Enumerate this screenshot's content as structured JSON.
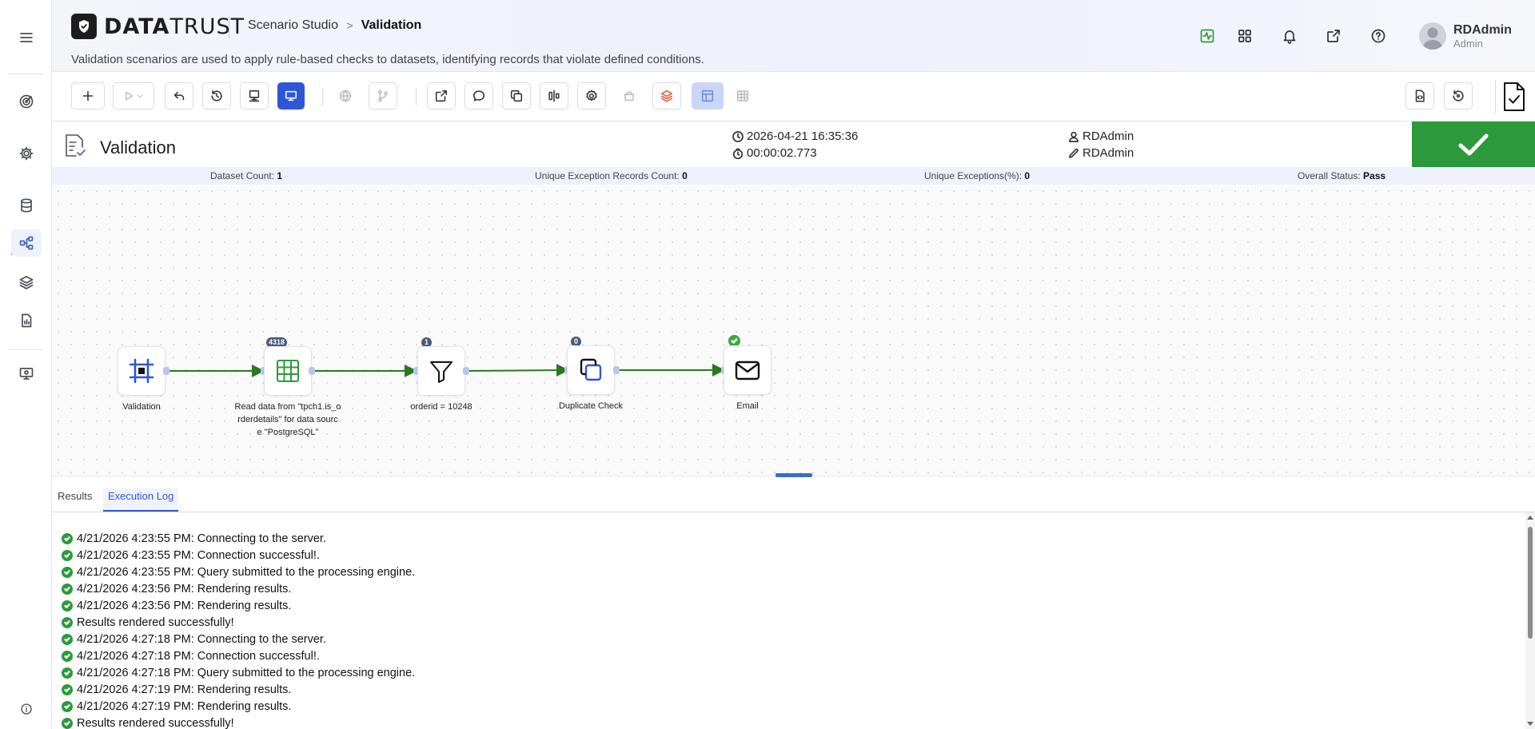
{
  "app": {
    "brand_bold": "DATA",
    "brand_light": "TRUST",
    "breadcrumb": {
      "parent": "Scenario Studio",
      "current": "Validation"
    },
    "subtitle": "Validation scenarios are used to apply rule-based checks to datasets, identifying records that violate defined conditions."
  },
  "user": {
    "name": "RDAdmin",
    "role": "Admin"
  },
  "header_icons": [
    "activity-icon",
    "apps-grid-icon",
    "bell-icon",
    "external-link-icon",
    "help-icon"
  ],
  "sidebar": {
    "items": [
      {
        "name": "target-icon",
        "active": false
      },
      {
        "name": "settings-icon",
        "active": false
      },
      {
        "name": "database-icon",
        "active": false
      },
      {
        "name": "workflow-icon",
        "active": true
      },
      {
        "name": "layers-icon",
        "active": false
      },
      {
        "name": "report-icon",
        "active": false
      },
      {
        "name": "monitor-icon",
        "active": false
      }
    ],
    "footer": "info-icon"
  },
  "scenario": {
    "title": "Validation",
    "run_datetime": "2026-04-21 16:35:36",
    "duration": "00:00:02.773",
    "created_by": "RDAdmin",
    "modified_by": "RDAdmin",
    "status_color": "#2c9a3b"
  },
  "summary": {
    "dataset_count_label": "Dataset Count:",
    "dataset_count": "1",
    "unique_exception_records_label": "Unique Exception Records Count:",
    "unique_exception_records": "0",
    "unique_exceptions_pct_label": "Unique Exceptions(%):",
    "unique_exceptions_pct": "0",
    "overall_status_label": "Overall Status:",
    "overall_status": "Pass"
  },
  "flow": {
    "nodes": [
      {
        "label": "Validation",
        "badge": "",
        "icon": "frame-icon"
      },
      {
        "label": "Read data from \"tpch1.is_orderdetails\" for data source \"PostgreSQL\"",
        "label_lines": [
          "Read data from \"tpch1.is_o",
          "rderdetails\" for data sourc",
          "e \"PostgreSQL\""
        ],
        "badge": "4318",
        "icon": "table-icon"
      },
      {
        "label": "orderid = 10248",
        "badge": "1",
        "icon": "filter-icon"
      },
      {
        "label": "Duplicate Check",
        "badge": "0",
        "icon": "duplicate-icon"
      },
      {
        "label": "Email",
        "badge": "",
        "icon": "mail-icon",
        "done": true
      }
    ],
    "edge_color": "#2a7a1f"
  },
  "tabs": [
    {
      "label": "Results",
      "active": false
    },
    {
      "label": "Execution Log",
      "active": true
    }
  ],
  "log": [
    "4/21/2026 4:23:55 PM: Connecting to the server.",
    "4/21/2026 4:23:55 PM: Connection successful!.",
    "4/21/2026 4:23:55 PM: Query submitted to the processing engine.",
    "4/21/2026 4:23:56 PM: Rendering results.",
    "4/21/2026 4:23:56 PM: Rendering results.",
    "Results rendered successfully!",
    "4/21/2026 4:27:18 PM: Connecting to the server.",
    "4/21/2026 4:27:18 PM: Connection successful!.",
    "4/21/2026 4:27:18 PM: Query submitted to the processing engine.",
    "4/21/2026 4:27:19 PM: Rendering results.",
    "4/21/2026 4:27:19 PM: Rendering results.",
    "Results rendered successfully!"
  ]
}
